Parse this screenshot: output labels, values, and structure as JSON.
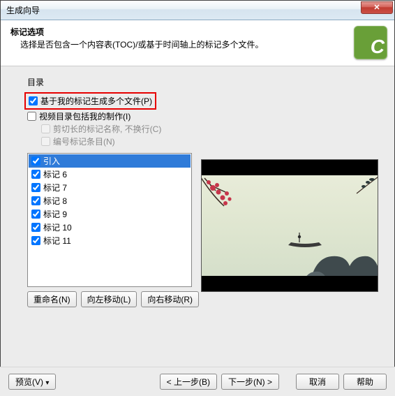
{
  "window": {
    "title": "生成向导"
  },
  "header": {
    "title": "标记选项",
    "desc": "选择是否包含一个内容表(TOC)/或基于时间轴上的标记多个文件。"
  },
  "section": {
    "label": "目录"
  },
  "checks": {
    "generate_multiple": "基于我的标记生成多个文件(P)",
    "include_my_production": "视频目录包括我的制作(I)",
    "trim_names": "剪切长的标记名称, 不换行(C)",
    "number_entries": "编号标记条目(N)"
  },
  "list": {
    "items": [
      {
        "label": "引入",
        "checked": true,
        "selected": true
      },
      {
        "label": "标记 6",
        "checked": true,
        "selected": false
      },
      {
        "label": "标记 7",
        "checked": true,
        "selected": false
      },
      {
        "label": "标记 8",
        "checked": true,
        "selected": false
      },
      {
        "label": "标记 9",
        "checked": true,
        "selected": false
      },
      {
        "label": "标记 10",
        "checked": true,
        "selected": false
      },
      {
        "label": "标记 11",
        "checked": true,
        "selected": false
      }
    ]
  },
  "buttons": {
    "rename": "重命名(N)",
    "move_left": "向左移动(L)",
    "move_right": "向右移动(R)",
    "preview": "预览(V)",
    "back": "< 上一步(B)",
    "next": "下一步(N) >",
    "cancel": "取消",
    "help": "帮助"
  }
}
